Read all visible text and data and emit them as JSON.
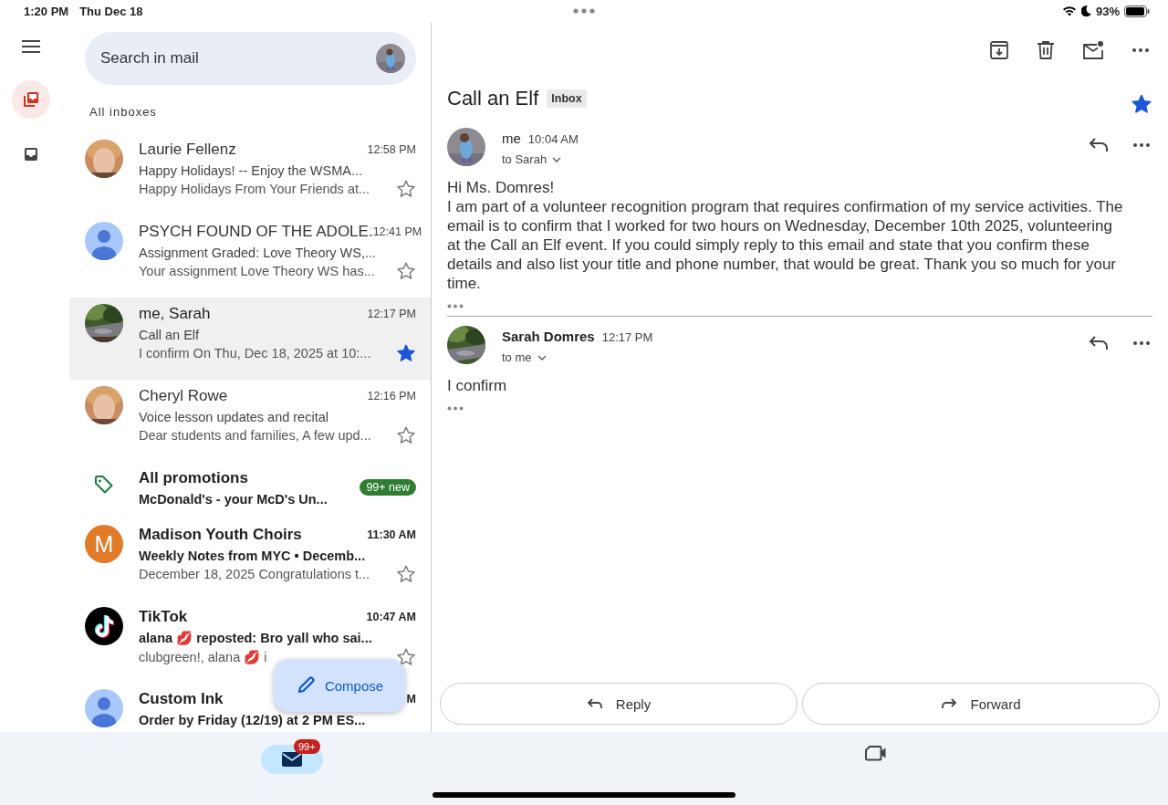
{
  "status_bar": {
    "time": "1:20 PM",
    "date": "Thu Dec 18",
    "battery": "93%"
  },
  "rail": [
    {
      "kind": "all-inboxes",
      "selected": true
    },
    {
      "kind": "inbox",
      "selected": false
    }
  ],
  "search": {
    "placeholder": "Search in mail"
  },
  "section_label": "All inboxes",
  "threads": [
    {
      "kind": "mail",
      "sender": "Laurie Fellenz",
      "time": "12:58 PM",
      "subject": "Happy Holidays! -- Enjoy the WSMA...",
      "snippet": "Happy Holidays From Your Friends at...",
      "starred": false,
      "unread": false,
      "selected": false
    },
    {
      "kind": "mail",
      "avatar": {
        "kind": "person"
      },
      "sender": "PSYCH FOUND OF THE ADOLE.",
      "time": "12:41 PM",
      "subject": "Assignment Graded: Love Theory WS,...",
      "snippet": "Your assignment Love Theory WS has...",
      "starred": false,
      "unread": false,
      "selected": false
    },
    {
      "kind": "mail",
      "sender": "me, Sarah",
      "time": "12:17 PM",
      "subject": "Call an Elf",
      "snippet": "I confirm On Thu, Dec 18, 2025 at 10:...",
      "starred": true,
      "unread": false,
      "selected": true
    },
    {
      "kind": "mail",
      "sender": "Cheryl Rowe",
      "time": "12:16 PM",
      "subject": "Voice lesson updates and recital",
      "snippet": "Dear students and families, A few upd...",
      "starred": false,
      "unread": false,
      "selected": false
    },
    {
      "kind": "promo",
      "title": "All promotions",
      "subject": "McDonald's - your McD's Un...",
      "badge": "99+ new"
    },
    {
      "kind": "mail",
      "avatar": {
        "kind": "letter",
        "text": "M"
      },
      "sender": "Madison Youth Choirs",
      "time": "11:30 AM",
      "subject": "Weekly Notes from MYC • Decemb...",
      "snippet": "December 18, 2025 Congratulations t...",
      "starred": false,
      "unread": true,
      "selected": false
    },
    {
      "kind": "mail",
      "avatar": {
        "kind": "logo"
      },
      "sender": "TikTok",
      "time": "10:47 AM",
      "subject": "alana 💋 reposted: Bro yall who sai...",
      "snippet": "clubgreen!, alana 💋 i",
      "starred": false,
      "unread": true,
      "selected": false
    },
    {
      "kind": "mail",
      "avatar": {
        "kind": "person"
      },
      "sender": "Custom Ink",
      "time": "M",
      "subject": "Order by Friday (12/19) at 2 PM ES...",
      "unread": true,
      "selected": false
    }
  ],
  "compose": {
    "label": "Compose"
  },
  "conversation": {
    "subject": "Call an Elf",
    "label": "Inbox",
    "starred": true,
    "messages": [
      {
        "sender": "me",
        "time": "10:04 AM",
        "to": "to Sarah",
        "unread": false,
        "paragraphs": [
          "Hi Ms. Domres!",
          "I am part of a volunteer recognition program that requires confirmation of my service activities. The email is to confirm that I worked for two hours on Wednesday, December 10th 2025, volunteering at the Call an Elf event. If you could simply reply to this email and state that you confirm these details and also list your title and phone number, that would be great. Thank you so much for your time."
        ]
      },
      {
        "sender": "Sarah Domres",
        "time": "12:17 PM",
        "to": "to me",
        "unread": true,
        "paragraphs": [
          "I confirm"
        ]
      }
    ],
    "actions": [
      "Reply",
      "Forward"
    ]
  },
  "bottom_nav": {
    "mail_badge": "99+"
  }
}
